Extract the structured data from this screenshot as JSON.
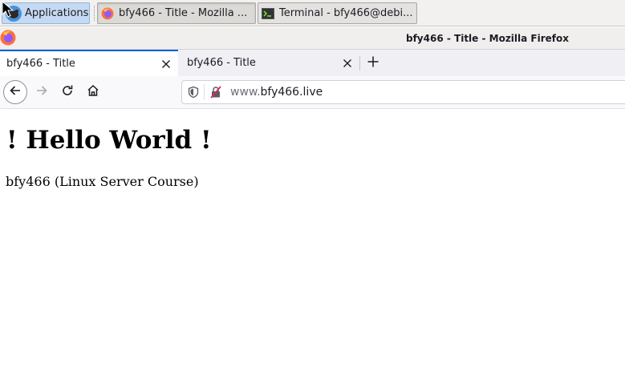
{
  "panel": {
    "applications_label": "Applications",
    "tasks": [
      {
        "label": "bfy466 - Title - Mozilla ...",
        "icon": "firefox-icon"
      },
      {
        "label": "Terminal - bfy466@debi...",
        "icon": "terminal-icon"
      }
    ]
  },
  "window": {
    "title": "bfy466 - Title - Mozilla Firefox"
  },
  "tabs": [
    {
      "title": "bfy466 - Title",
      "selected": true
    },
    {
      "title": "bfy466 - Title",
      "selected": false
    }
  ],
  "urlbar": {
    "prefix": "www.",
    "domain": "bfy466.live"
  },
  "page": {
    "heading": "! Hello World !",
    "paragraph": "bfy466 (Linux Server Course)"
  },
  "colors": {
    "accent": "#0061e0",
    "panel_bg": "#f2f1f0",
    "tab_strip_bg": "#f0f0f4",
    "apps_button_bg": "#c5daf2"
  }
}
